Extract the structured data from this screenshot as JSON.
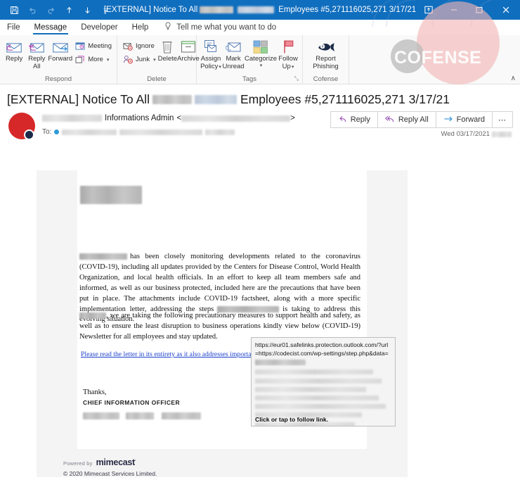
{
  "titlebar": {
    "quick_access": [
      {
        "name": "save-icon",
        "glyph": "὚B"
      },
      {
        "name": "undo-icon",
        "glyph": "↶"
      },
      {
        "name": "redo-icon",
        "glyph": "↷"
      },
      {
        "name": "previous-item-icon",
        "glyph": "↑"
      },
      {
        "name": "next-item-icon",
        "glyph": "↓"
      },
      {
        "name": "customize-qat-icon",
        "glyph": "▾"
      }
    ],
    "title_prefix": "[EXTERNAL] Notice To All",
    "title_suffix": "Employees #5,271116025,271 3/17/21",
    "controls": {
      "restore_ribbon": "▣",
      "minimize": "–",
      "maximize": "❑",
      "close": "✕"
    }
  },
  "tabs": [
    {
      "label": "File",
      "active": false
    },
    {
      "label": "Message",
      "active": true
    },
    {
      "label": "Developer",
      "active": false
    },
    {
      "label": "Help",
      "active": false
    }
  ],
  "tell_me": {
    "icon": "lightbulb-icon",
    "label": "Tell me what you want to do"
  },
  "ribbon": {
    "collapse_label": "∧",
    "groups": [
      {
        "label": "Respond",
        "big_buttons": [
          {
            "name": "reply-button",
            "label": "Reply",
            "icon": "reply-envelope-icon"
          },
          {
            "name": "reply-all-button",
            "label": "Reply\nAll",
            "line1": "Reply",
            "line2": "All",
            "icon": "reply-all-envelope-icon"
          },
          {
            "name": "forward-button",
            "label": "Forward",
            "icon": "forward-envelope-icon"
          }
        ],
        "small_buttons": [
          {
            "name": "meeting-button",
            "label": "Meeting",
            "icon": "meeting-icon",
            "caret": false
          },
          {
            "name": "more-respond-button",
            "label": "More",
            "icon": "more-icon",
            "caret": true
          }
        ]
      },
      {
        "label": "Delete",
        "small_buttons": [
          {
            "name": "ignore-button",
            "label": "Ignore",
            "icon": "ignore-icon",
            "caret": false
          },
          {
            "name": "junk-button",
            "label": "Junk",
            "icon": "junk-icon",
            "caret": true
          }
        ],
        "big_buttons": [
          {
            "name": "delete-button",
            "label": "Delete",
            "icon": "trash-icon"
          },
          {
            "name": "archive-button",
            "label": "Archive",
            "icon": "archive-icon"
          }
        ]
      },
      {
        "label": "Tags",
        "has_dialog_launcher": true,
        "dialog_launcher_glyph": "⤡",
        "big_buttons": [
          {
            "name": "assign-policy-button",
            "line1": "Assign",
            "line2": "Policy",
            "icon": "assign-policy-icon",
            "caret": true
          },
          {
            "name": "mark-unread-button",
            "line1": "Mark",
            "line2": "Unread",
            "icon": "mark-unread-icon",
            "caret": false
          },
          {
            "name": "categorize-button",
            "line1": "Categorize",
            "line2": "",
            "icon": "categorize-icon",
            "caret": true
          },
          {
            "name": "follow-up-button",
            "line1": "Follow",
            "line2": "Up",
            "icon": "follow-up-flag-icon",
            "caret": true
          }
        ]
      },
      {
        "label": "Cofense",
        "big_buttons": [
          {
            "name": "report-phishing-button",
            "line1": "Report",
            "line2": "Phishing",
            "icon": "phish-fish-icon"
          }
        ]
      }
    ]
  },
  "watermark": {
    "text": "COFENSE",
    "circle_pink": "#f2b4b4",
    "circle_gray": "#b9b9b9"
  },
  "subject": {
    "prefix": "[EXTERNAL] Notice To All",
    "suffix": "Employees #5,271116025,271 3/17/21"
  },
  "sender": {
    "display_name_suffix": "Informations Admin",
    "email_open": "<",
    "email_close": ">",
    "to_label": "To:",
    "timestamp": "Wed 03/17/2021",
    "avatar_color": "#d62828",
    "presence_color": "#1b2a47"
  },
  "reply_bar": [
    {
      "name": "reply-button-header",
      "label": "Reply",
      "icon": "reply-arrow-icon"
    },
    {
      "name": "reply-all-button-header",
      "label": "Reply All",
      "icon": "reply-all-arrow-icon"
    },
    {
      "name": "forward-button-header",
      "label": "Forward",
      "icon": "forward-arrow-icon"
    },
    {
      "name": "more-actions-button",
      "label": "⋯",
      "icon": "ellipsis-icon"
    }
  ],
  "body": {
    "paragraph1_part1": "has been closely monitoring developments related to the coronavirus (COVID-19), including all updates provided by the Centers for Disease Control, World Health Organization, and local health officials.  In an effort to keep all team members safe and informed, as well as our business protected, included here are the precautions that have been put in place. The attachments include COVID-19 factsheet,  along with a more specific implementation letter, addressing the steps",
    "paragraph1_part2": "is taking to address this evolving situation.",
    "paragraph2_part1": ", we are taking the following precautionary measures to support health and safety, as well as to ensure the least disruption to business operations kindly view below (COVID-19) Newsletter for all employees and stay updated.",
    "link_text": "Please read the letter in its entirety as it also addresses important changes to business operations.",
    "signature_thanks": "Thanks,",
    "signature_title": "CHIEF INFORMATION OFFICER"
  },
  "footer": {
    "powered_by": "Powered by",
    "logo": "mimecast",
    "logo_mark": "·",
    "copyright": "© 2020 Mimecast Services Limited."
  },
  "tooltip": {
    "url": "https://eur01.safelinks.protection.outlook.com/?url=https://codecist.com/wp-settings/step.php&data=",
    "footer": "Click or tap to follow link."
  }
}
